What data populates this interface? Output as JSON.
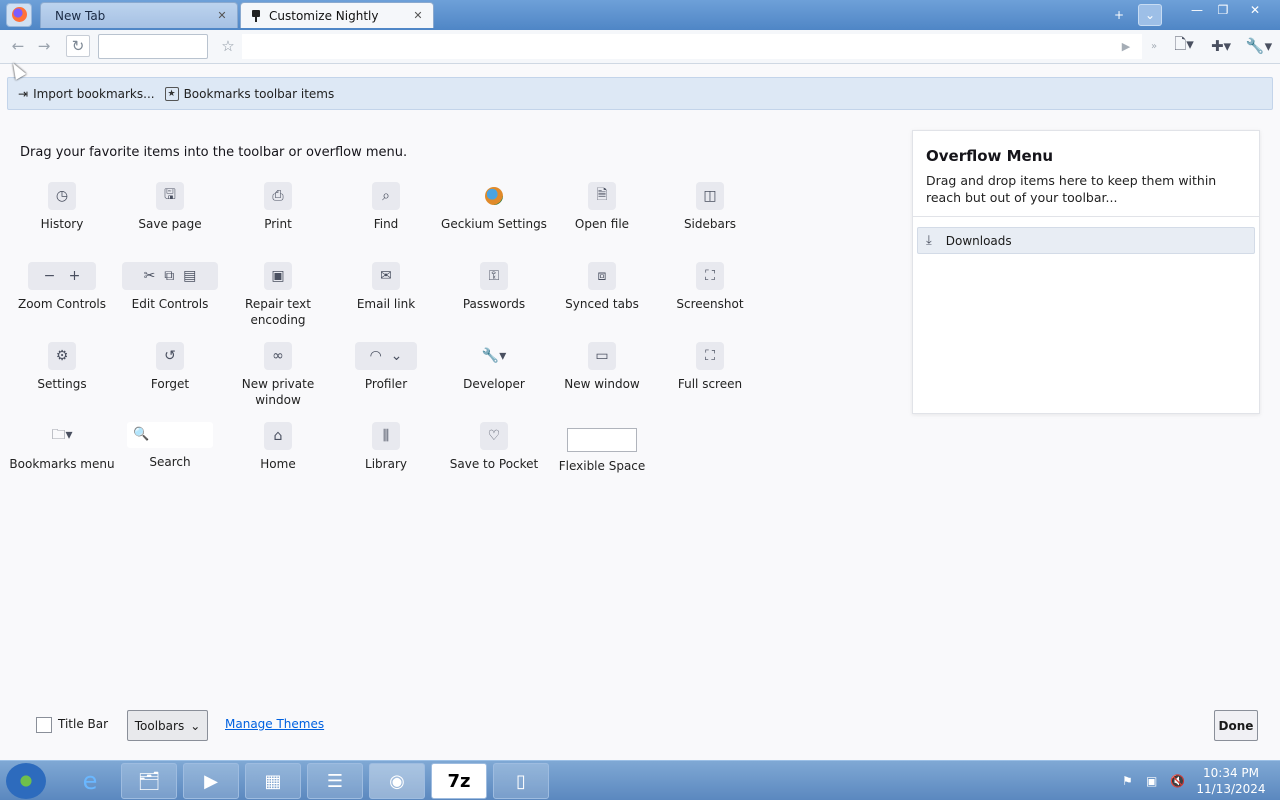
{
  "window": {
    "tabs": [
      {
        "title": "New Tab",
        "active": false
      },
      {
        "title": "Customize Nightly",
        "active": true
      }
    ]
  },
  "bookmarks_toolbar": {
    "items": [
      "Import bookmarks...",
      "Bookmarks toolbar items"
    ]
  },
  "palette": {
    "heading": "Drag your favorite items into the toolbar or overflow menu.",
    "items": [
      {
        "label": "History",
        "icon": "clock-icon"
      },
      {
        "label": "Save page",
        "icon": "save-page-icon"
      },
      {
        "label": "Print",
        "icon": "printer-icon"
      },
      {
        "label": "Find",
        "icon": "magnifier-icon"
      },
      {
        "label": "Geckium Settings",
        "icon": "geckium-icon"
      },
      {
        "label": "Open file",
        "icon": "open-file-icon"
      },
      {
        "label": "Sidebars",
        "icon": "sidebar-icon"
      },
      {
        "label": "Zoom Controls",
        "icon": "zoom-controls-icon"
      },
      {
        "label": "Edit Controls",
        "icon": "edit-controls-icon"
      },
      {
        "label": "Repair text encoding",
        "icon": "text-encoding-icon"
      },
      {
        "label": "Email link",
        "icon": "envelope-icon"
      },
      {
        "label": "Passwords",
        "icon": "key-icon"
      },
      {
        "label": "Synced tabs",
        "icon": "synced-tabs-icon"
      },
      {
        "label": "Screenshot",
        "icon": "screenshot-icon"
      },
      {
        "label": "Settings",
        "icon": "gear-icon"
      },
      {
        "label": "Forget",
        "icon": "forget-icon"
      },
      {
        "label": "New private window",
        "icon": "private-mask-icon"
      },
      {
        "label": "Profiler",
        "icon": "profiler-icon"
      },
      {
        "label": "Developer",
        "icon": "wrench-icon"
      },
      {
        "label": "New window",
        "icon": "new-window-icon"
      },
      {
        "label": "Full screen",
        "icon": "fullscreen-icon"
      },
      {
        "label": "Bookmarks menu",
        "icon": "bookmarks-menu-icon"
      },
      {
        "label": "Search",
        "icon": "search-icon"
      },
      {
        "label": "Home",
        "icon": "home-icon"
      },
      {
        "label": "Library",
        "icon": "library-icon"
      },
      {
        "label": "Save to Pocket",
        "icon": "pocket-icon"
      },
      {
        "label": "Flexible Space",
        "icon": "flexible-space"
      }
    ]
  },
  "overflow": {
    "title": "Overflow Menu",
    "description": "Drag and drop items here to keep them within reach but out of your toolbar...",
    "items": [
      {
        "label": "Downloads",
        "icon": "download-icon"
      }
    ]
  },
  "footer": {
    "title_bar_label": "Title Bar",
    "title_bar_checked": false,
    "toolbars_label": "Toolbars",
    "manage_themes_label": "Manage Themes",
    "done_label": "Done"
  },
  "taskbar": {
    "time": "10:34 PM",
    "date": "11/13/2024"
  }
}
